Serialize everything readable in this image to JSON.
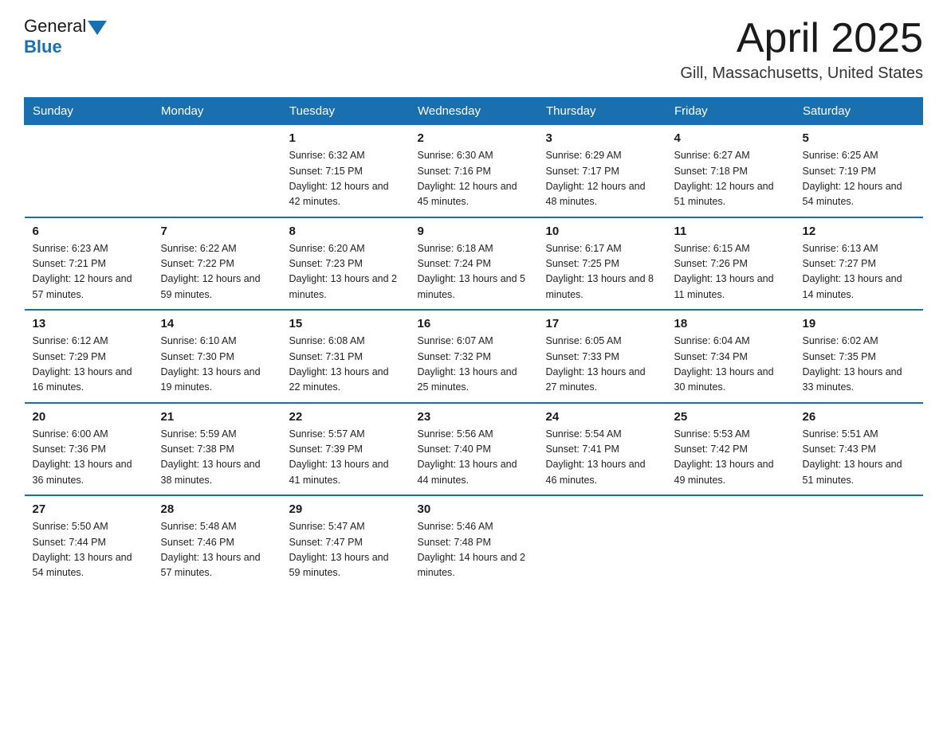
{
  "header": {
    "logo_general": "General",
    "logo_blue": "Blue",
    "title": "April 2025",
    "subtitle": "Gill, Massachusetts, United States"
  },
  "days_of_week": [
    "Sunday",
    "Monday",
    "Tuesday",
    "Wednesday",
    "Thursday",
    "Friday",
    "Saturday"
  ],
  "weeks": [
    [
      {
        "day": "",
        "sunrise": "",
        "sunset": "",
        "daylight": ""
      },
      {
        "day": "",
        "sunrise": "",
        "sunset": "",
        "daylight": ""
      },
      {
        "day": "1",
        "sunrise": "Sunrise: 6:32 AM",
        "sunset": "Sunset: 7:15 PM",
        "daylight": "Daylight: 12 hours and 42 minutes."
      },
      {
        "day": "2",
        "sunrise": "Sunrise: 6:30 AM",
        "sunset": "Sunset: 7:16 PM",
        "daylight": "Daylight: 12 hours and 45 minutes."
      },
      {
        "day": "3",
        "sunrise": "Sunrise: 6:29 AM",
        "sunset": "Sunset: 7:17 PM",
        "daylight": "Daylight: 12 hours and 48 minutes."
      },
      {
        "day": "4",
        "sunrise": "Sunrise: 6:27 AM",
        "sunset": "Sunset: 7:18 PM",
        "daylight": "Daylight: 12 hours and 51 minutes."
      },
      {
        "day": "5",
        "sunrise": "Sunrise: 6:25 AM",
        "sunset": "Sunset: 7:19 PM",
        "daylight": "Daylight: 12 hours and 54 minutes."
      }
    ],
    [
      {
        "day": "6",
        "sunrise": "Sunrise: 6:23 AM",
        "sunset": "Sunset: 7:21 PM",
        "daylight": "Daylight: 12 hours and 57 minutes."
      },
      {
        "day": "7",
        "sunrise": "Sunrise: 6:22 AM",
        "sunset": "Sunset: 7:22 PM",
        "daylight": "Daylight: 12 hours and 59 minutes."
      },
      {
        "day": "8",
        "sunrise": "Sunrise: 6:20 AM",
        "sunset": "Sunset: 7:23 PM",
        "daylight": "Daylight: 13 hours and 2 minutes."
      },
      {
        "day": "9",
        "sunrise": "Sunrise: 6:18 AM",
        "sunset": "Sunset: 7:24 PM",
        "daylight": "Daylight: 13 hours and 5 minutes."
      },
      {
        "day": "10",
        "sunrise": "Sunrise: 6:17 AM",
        "sunset": "Sunset: 7:25 PM",
        "daylight": "Daylight: 13 hours and 8 minutes."
      },
      {
        "day": "11",
        "sunrise": "Sunrise: 6:15 AM",
        "sunset": "Sunset: 7:26 PM",
        "daylight": "Daylight: 13 hours and 11 minutes."
      },
      {
        "day": "12",
        "sunrise": "Sunrise: 6:13 AM",
        "sunset": "Sunset: 7:27 PM",
        "daylight": "Daylight: 13 hours and 14 minutes."
      }
    ],
    [
      {
        "day": "13",
        "sunrise": "Sunrise: 6:12 AM",
        "sunset": "Sunset: 7:29 PM",
        "daylight": "Daylight: 13 hours and 16 minutes."
      },
      {
        "day": "14",
        "sunrise": "Sunrise: 6:10 AM",
        "sunset": "Sunset: 7:30 PM",
        "daylight": "Daylight: 13 hours and 19 minutes."
      },
      {
        "day": "15",
        "sunrise": "Sunrise: 6:08 AM",
        "sunset": "Sunset: 7:31 PM",
        "daylight": "Daylight: 13 hours and 22 minutes."
      },
      {
        "day": "16",
        "sunrise": "Sunrise: 6:07 AM",
        "sunset": "Sunset: 7:32 PM",
        "daylight": "Daylight: 13 hours and 25 minutes."
      },
      {
        "day": "17",
        "sunrise": "Sunrise: 6:05 AM",
        "sunset": "Sunset: 7:33 PM",
        "daylight": "Daylight: 13 hours and 27 minutes."
      },
      {
        "day": "18",
        "sunrise": "Sunrise: 6:04 AM",
        "sunset": "Sunset: 7:34 PM",
        "daylight": "Daylight: 13 hours and 30 minutes."
      },
      {
        "day": "19",
        "sunrise": "Sunrise: 6:02 AM",
        "sunset": "Sunset: 7:35 PM",
        "daylight": "Daylight: 13 hours and 33 minutes."
      }
    ],
    [
      {
        "day": "20",
        "sunrise": "Sunrise: 6:00 AM",
        "sunset": "Sunset: 7:36 PM",
        "daylight": "Daylight: 13 hours and 36 minutes."
      },
      {
        "day": "21",
        "sunrise": "Sunrise: 5:59 AM",
        "sunset": "Sunset: 7:38 PM",
        "daylight": "Daylight: 13 hours and 38 minutes."
      },
      {
        "day": "22",
        "sunrise": "Sunrise: 5:57 AM",
        "sunset": "Sunset: 7:39 PM",
        "daylight": "Daylight: 13 hours and 41 minutes."
      },
      {
        "day": "23",
        "sunrise": "Sunrise: 5:56 AM",
        "sunset": "Sunset: 7:40 PM",
        "daylight": "Daylight: 13 hours and 44 minutes."
      },
      {
        "day": "24",
        "sunrise": "Sunrise: 5:54 AM",
        "sunset": "Sunset: 7:41 PM",
        "daylight": "Daylight: 13 hours and 46 minutes."
      },
      {
        "day": "25",
        "sunrise": "Sunrise: 5:53 AM",
        "sunset": "Sunset: 7:42 PM",
        "daylight": "Daylight: 13 hours and 49 minutes."
      },
      {
        "day": "26",
        "sunrise": "Sunrise: 5:51 AM",
        "sunset": "Sunset: 7:43 PM",
        "daylight": "Daylight: 13 hours and 51 minutes."
      }
    ],
    [
      {
        "day": "27",
        "sunrise": "Sunrise: 5:50 AM",
        "sunset": "Sunset: 7:44 PM",
        "daylight": "Daylight: 13 hours and 54 minutes."
      },
      {
        "day": "28",
        "sunrise": "Sunrise: 5:48 AM",
        "sunset": "Sunset: 7:46 PM",
        "daylight": "Daylight: 13 hours and 57 minutes."
      },
      {
        "day": "29",
        "sunrise": "Sunrise: 5:47 AM",
        "sunset": "Sunset: 7:47 PM",
        "daylight": "Daylight: 13 hours and 59 minutes."
      },
      {
        "day": "30",
        "sunrise": "Sunrise: 5:46 AM",
        "sunset": "Sunset: 7:48 PM",
        "daylight": "Daylight: 14 hours and 2 minutes."
      },
      {
        "day": "",
        "sunrise": "",
        "sunset": "",
        "daylight": ""
      },
      {
        "day": "",
        "sunrise": "",
        "sunset": "",
        "daylight": ""
      },
      {
        "day": "",
        "sunrise": "",
        "sunset": "",
        "daylight": ""
      }
    ]
  ]
}
